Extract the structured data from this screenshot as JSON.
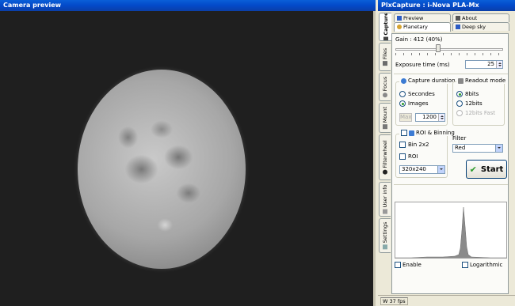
{
  "preview": {
    "title": "Camera preview"
  },
  "app": {
    "title": "PlxCapture : i-Nova PLA-Mx"
  },
  "vertical_tabs": [
    {
      "label": "Capture"
    },
    {
      "label": "Files"
    },
    {
      "label": "Focus"
    },
    {
      "label": "Mount"
    },
    {
      "label": "Filterwheel"
    },
    {
      "label": "User info"
    },
    {
      "label": "Settings"
    }
  ],
  "top_tabs": [
    {
      "label": "Preview"
    },
    {
      "label": "About"
    },
    {
      "label": "Planetary"
    },
    {
      "label": "Deep sky"
    }
  ],
  "gain": {
    "label": "Gain : 412 (40%)",
    "percent": 40
  },
  "exposure": {
    "label": "Exposure time (ms)",
    "value": "25"
  },
  "capture_duration": {
    "title": "Capture duration",
    "opt_seconds": "Secondes",
    "opt_images": "Images",
    "max_label": "Max",
    "count": "1200"
  },
  "readout": {
    "title": "Readout mode",
    "opt_8": "8bits",
    "opt_12": "12bits",
    "opt_12fast": "12bits Fast"
  },
  "roi": {
    "title": "ROI & Binning",
    "bin_label": "Bin 2x2",
    "roi_label": "ROI",
    "size_value": "320x240"
  },
  "filter": {
    "label": "Filter",
    "value": "Red"
  },
  "start": {
    "label": "Start"
  },
  "histogram": {
    "enable_label": "Enable",
    "log_label": "Logarithmic"
  },
  "status": {
    "fps": "W 37 fps"
  },
  "colors": {
    "titlebar": "#0349c9",
    "start_check": "#2b9b2b"
  }
}
